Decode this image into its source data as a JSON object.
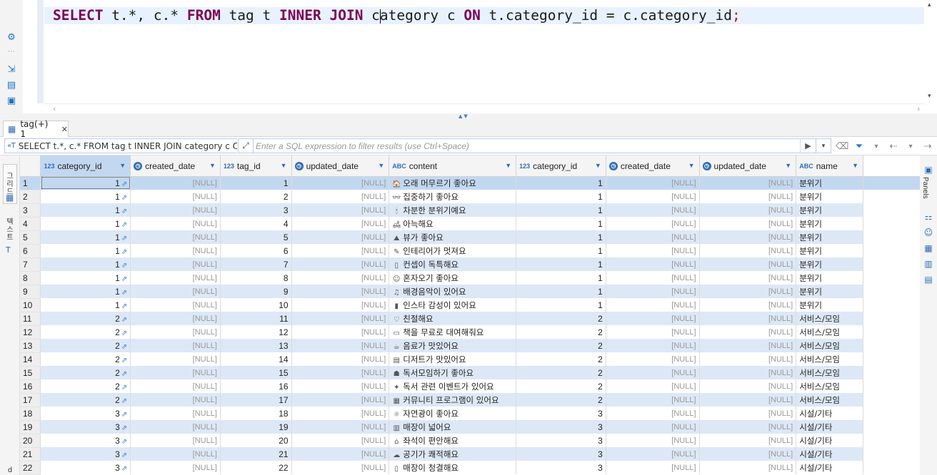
{
  "editor": {
    "sql_tokens": [
      {
        "t": "SELECT",
        "k": "kw"
      },
      {
        "t": " t.*, c.* ",
        "k": ""
      },
      {
        "t": "FROM",
        "k": "kw"
      },
      {
        "t": " tag t ",
        "k": ""
      },
      {
        "t": "INNER",
        "k": "kw"
      },
      {
        "t": " ",
        "k": ""
      },
      {
        "t": "JOIN",
        "k": "kw"
      },
      {
        "t": " c",
        "k": ""
      },
      {
        "t": "",
        "k": "caret"
      },
      {
        "t": "ategory c ",
        "k": ""
      },
      {
        "t": "ON",
        "k": "kw"
      },
      {
        "t": " t.category_id = c.category_id",
        "k": ""
      },
      {
        "t": ";",
        "k": "semi"
      }
    ]
  },
  "results_tab": {
    "label": "tag(+) 1"
  },
  "filter": {
    "query_text": "SELECT t.*, c.* FROM tag t INNER JOIN category c ON t",
    "placeholder": "Enter a SQL expression to filter results (use Ctrl+Space)"
  },
  "side_panel": {
    "grid_label": "그리드",
    "text_label": "텍스트"
  },
  "right_panel": {
    "panels_label": "Panels"
  },
  "grid": {
    "null_text": "[NULL]",
    "columns": [
      {
        "name": "category_id",
        "type": "123",
        "width": 126
      },
      {
        "name": "created_date",
        "type": "clock",
        "width": 126
      },
      {
        "name": "tag_id",
        "type": "123",
        "width": 100
      },
      {
        "name": "updated_date",
        "type": "clock",
        "width": 137
      },
      {
        "name": "content",
        "type": "ABC",
        "width": 178
      },
      {
        "name": "category_id",
        "type": "123",
        "width": 126
      },
      {
        "name": "created_date",
        "type": "clock",
        "width": 131
      },
      {
        "name": "updated_date",
        "type": "clock",
        "width": 136
      },
      {
        "name": "name",
        "type": "ABC",
        "width": 94
      }
    ],
    "rows": [
      {
        "n": "1",
        "tcat": "1",
        "tag": "1",
        "icon": "🏠",
        "content": "오래 머무르기 좋아요",
        "ccat": "1",
        "name": "분위기"
      },
      {
        "n": "2",
        "tcat": "1",
        "tag": "2",
        "icon": "👓",
        "content": "집중하기 좋아요",
        "ccat": "1",
        "name": "분위기"
      },
      {
        "n": "3",
        "tcat": "1",
        "tag": "3",
        "icon": "🕯",
        "content": "차분한 분위기예요",
        "ccat": "1",
        "name": "분위기"
      },
      {
        "n": "4",
        "tcat": "1",
        "tag": "4",
        "icon": "🛋",
        "content": "아늑해요",
        "ccat": "1",
        "name": "분위기"
      },
      {
        "n": "5",
        "tcat": "1",
        "tag": "5",
        "icon": "⛰",
        "content": "뷰가 좋아요",
        "ccat": "1",
        "name": "분위기"
      },
      {
        "n": "6",
        "tcat": "1",
        "tag": "6",
        "icon": "✎",
        "content": "인테리어가 멋져요",
        "ccat": "1",
        "name": "분위기"
      },
      {
        "n": "7",
        "tcat": "1",
        "tag": "7",
        "icon": "▯",
        "content": "컨셉이 독특해요",
        "ccat": "1",
        "name": "분위기"
      },
      {
        "n": "8",
        "tcat": "1",
        "tag": "8",
        "icon": "☺",
        "content": "혼자오기 좋아요",
        "ccat": "1",
        "name": "분위기"
      },
      {
        "n": "9",
        "tcat": "1",
        "tag": "9",
        "icon": "♫",
        "content": "배경음악이 있어요",
        "ccat": "1",
        "name": "분위기"
      },
      {
        "n": "10",
        "tcat": "1",
        "tag": "10",
        "icon": "▮",
        "content": "인스타 감성이 있어요",
        "ccat": "1",
        "name": "분위기"
      },
      {
        "n": "11",
        "tcat": "2",
        "tag": "11",
        "icon": "♡",
        "content": "친절해요",
        "ccat": "2",
        "name": "서비스/모임"
      },
      {
        "n": "12",
        "tcat": "2",
        "tag": "12",
        "icon": "▭",
        "content": "책을 무료로 대여해줘요",
        "ccat": "2",
        "name": "서비스/모임"
      },
      {
        "n": "13",
        "tcat": "2",
        "tag": "13",
        "icon": "☕",
        "content": "음료가 맛있어요",
        "ccat": "2",
        "name": "서비스/모임"
      },
      {
        "n": "14",
        "tcat": "2",
        "tag": "14",
        "icon": "▤",
        "content": "디저트가 맛있어요",
        "ccat": "2",
        "name": "서비스/모임"
      },
      {
        "n": "15",
        "tcat": "2",
        "tag": "15",
        "icon": "☗",
        "content": "독서모임하기 좋아요",
        "ccat": "2",
        "name": "서비스/모임"
      },
      {
        "n": "16",
        "tcat": "2",
        "tag": "16",
        "icon": "✦",
        "content": "독서 관련 이벤트가 있어요",
        "ccat": "2",
        "name": "서비스/모임"
      },
      {
        "n": "17",
        "tcat": "2",
        "tag": "17",
        "icon": "▦",
        "content": "커뮤니티 프로그램이 있어요",
        "ccat": "2",
        "name": "서비스/모임"
      },
      {
        "n": "18",
        "tcat": "3",
        "tag": "18",
        "icon": "☼",
        "content": "자연광이 좋아요",
        "ccat": "3",
        "name": "시설/기타"
      },
      {
        "n": "19",
        "tcat": "3",
        "tag": "19",
        "icon": "▥",
        "content": "매장이 넓어요",
        "ccat": "3",
        "name": "시설/기타"
      },
      {
        "n": "20",
        "tcat": "3",
        "tag": "20",
        "icon": "⌂",
        "content": "좌석이 편안해요",
        "ccat": "3",
        "name": "시설/기타"
      },
      {
        "n": "21",
        "tcat": "3",
        "tag": "21",
        "icon": "☁",
        "content": "공기가 쾌적해요",
        "ccat": "3",
        "name": "시설/기타"
      },
      {
        "n": "22",
        "tcat": "3",
        "tag": "22",
        "icon": "▯",
        "content": "매장이 청결해요",
        "ccat": "3",
        "name": "시설/기타"
      }
    ]
  }
}
